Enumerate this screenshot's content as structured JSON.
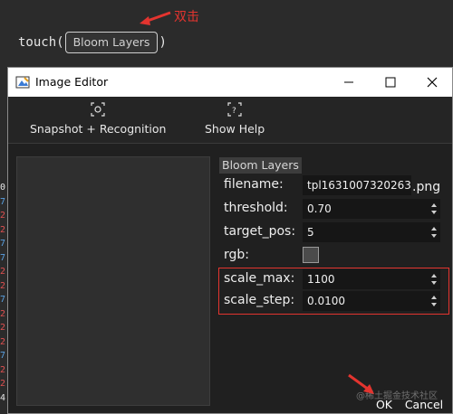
{
  "background": {
    "code_prefix": "touch(",
    "code_suffix": ")",
    "code_chip": "Bloom Layers",
    "annotation": "双击",
    "gutter_chars": [
      {
        "ch": "0",
        "color": "#e6e6e6"
      },
      {
        "ch": "7",
        "color": "#5aa0e0"
      },
      {
        "ch": "2",
        "color": "#e05050"
      },
      {
        "ch": "2",
        "color": "#e05050"
      },
      {
        "ch": "7",
        "color": "#5aa0e0"
      },
      {
        "ch": "7",
        "color": "#5aa0e0"
      },
      {
        "ch": "2",
        "color": "#e05050"
      },
      {
        "ch": "2",
        "color": "#e05050"
      },
      {
        "ch": "7",
        "color": "#5aa0e0"
      },
      {
        "ch": "2",
        "color": "#e05050"
      },
      {
        "ch": "2",
        "color": "#e05050"
      },
      {
        "ch": "2",
        "color": "#e05050"
      },
      {
        "ch": "7",
        "color": "#5aa0e0"
      },
      {
        "ch": "2",
        "color": "#e05050"
      },
      {
        "ch": "2",
        "color": "#e05050"
      },
      {
        "ch": "4",
        "color": "#e6e6e6"
      }
    ]
  },
  "window": {
    "title": "Image Editor",
    "toolbar": {
      "snapshot_label": "Snapshot + Recognition",
      "help_label": "Show Help"
    },
    "group_title": "Bloom Layers",
    "fields": {
      "filename": {
        "label": "filename:",
        "value": "tpl1631007320263",
        "ext": ".png"
      },
      "threshold": {
        "label": "threshold:",
        "value": "0.70"
      },
      "target_pos": {
        "label": "target_pos:",
        "value": "5"
      },
      "rgb": {
        "label": "rgb:",
        "checked": false
      },
      "scale_max": {
        "label": "scale_max:",
        "value": "1100"
      },
      "scale_step": {
        "label": "scale_step:",
        "value": "0.0100"
      }
    },
    "ok_label": "OK",
    "cancel_label": "Cancel",
    "watermark": "@稀土掘金技术社区"
  },
  "colors": {
    "annotation": "#e3342f",
    "dialog_bg": "#202020"
  }
}
